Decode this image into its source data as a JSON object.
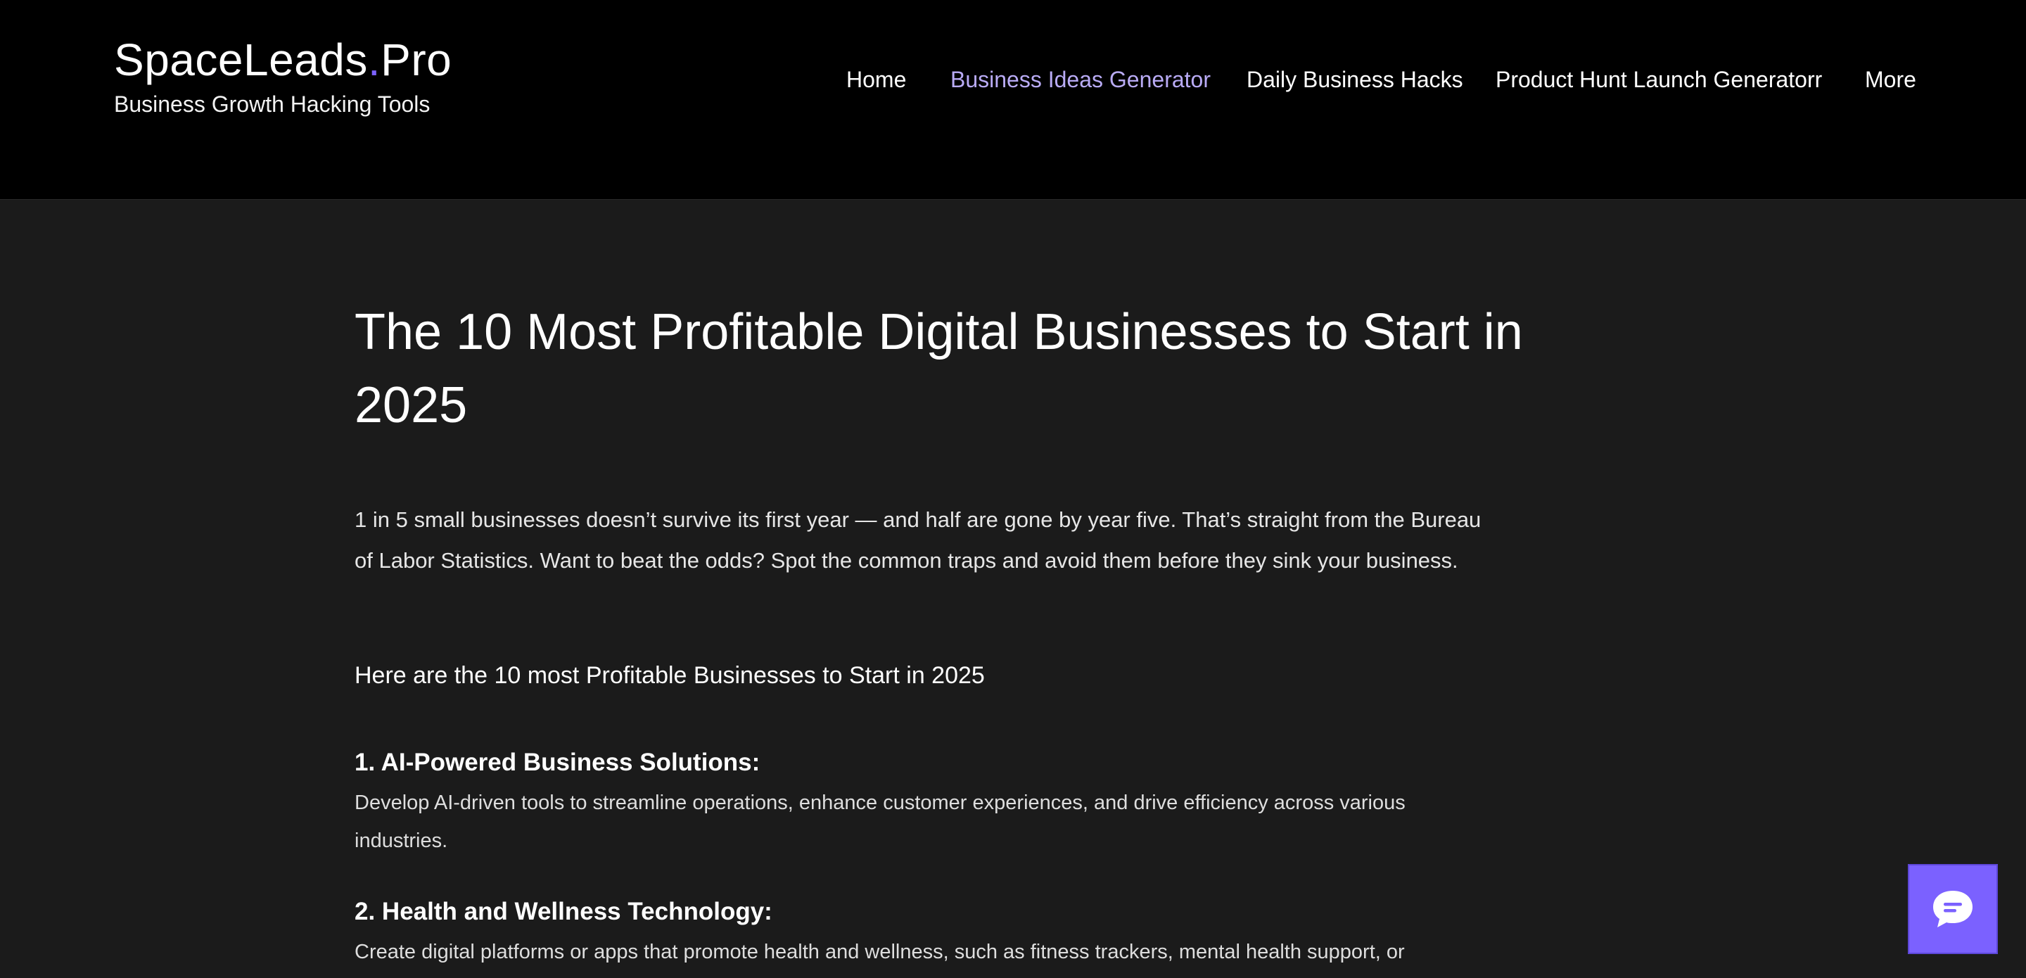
{
  "header": {
    "brand": {
      "name_part1": "SpaceLeads",
      "name_dot": ".",
      "name_part2": "Pro",
      "tagline": "Business Growth Hacking Tools"
    },
    "nav": [
      {
        "label": "Home",
        "active": false
      },
      {
        "label": "Business Ideas Generator",
        "active": true
      },
      {
        "label": "Daily Business Hacks",
        "active": false
      },
      {
        "label": "Product Hunt Launch Generatorr",
        "active": false
      },
      {
        "label": "More",
        "active": false
      }
    ]
  },
  "article": {
    "title": "The 10 Most Profitable Digital Businesses to Start in 2025",
    "intro": "1 in 5 small businesses doesn’t survive its first year — and half are gone by year five. That’s straight from the Bureau of Labor Statistics. Want to beat the odds? Spot the common traps and avoid them before they sink your business.",
    "subheading": "Here are the 10 most Profitable Businesses to Start in 2025",
    "items": [
      {
        "title": "1. AI-Powered Business Solutions:",
        "description": "Develop AI-driven tools to streamline operations, enhance customer experiences, and drive efficiency across various industries."
      },
      {
        "title": "2. Health and Wellness Technology:",
        "description": "Create digital platforms or apps that promote health and wellness, such as fitness trackers, mental health support, or"
      }
    ]
  },
  "chat_widget": {
    "icon": "chat-bubble-icon"
  },
  "colors": {
    "header_bg": "#000000",
    "page_bg": "#1b1b1b",
    "accent": "#7b61ff",
    "nav_active": "#b9abf5",
    "text": "#ffffff"
  }
}
